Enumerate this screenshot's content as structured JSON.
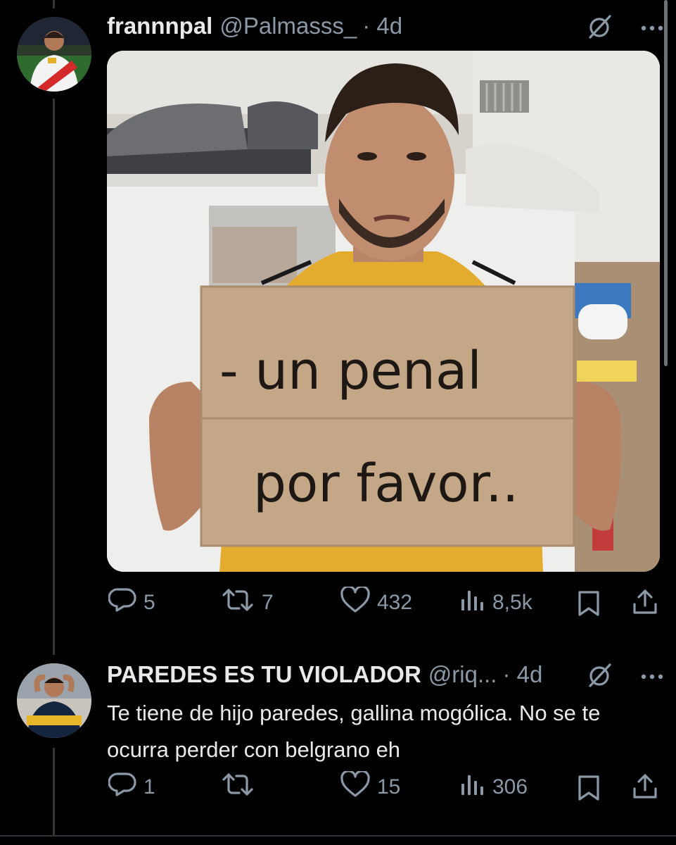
{
  "tweet1": {
    "display_name": "frannnpal",
    "handle": "@Palmasss_",
    "time": "· 4d",
    "sign_text_line1": "- un penal",
    "sign_text_line2": "por favor..",
    "actions": {
      "replies": "5",
      "retweets": "7",
      "likes": "432",
      "views": "8,5k"
    }
  },
  "tweet2": {
    "display_name": "PAREDES ES TU VIOLADOR",
    "handle": "@riq...",
    "time": "· 4d",
    "text": "Te tiene de hijo paredes, gallina mogólica. No se te ocurra perder con belgrano eh",
    "actions": {
      "replies": "1",
      "retweets": "",
      "likes": "15",
      "views": "306"
    }
  },
  "icons": [
    "grok-icon",
    "more-icon",
    "reply-icon",
    "retweet-icon",
    "like-icon",
    "views-icon",
    "bookmark-icon",
    "share-icon"
  ],
  "colors": {
    "background": "#000000",
    "text": "#e7e9ea",
    "muted": "#8b98a5",
    "thread_line": "#333639"
  }
}
